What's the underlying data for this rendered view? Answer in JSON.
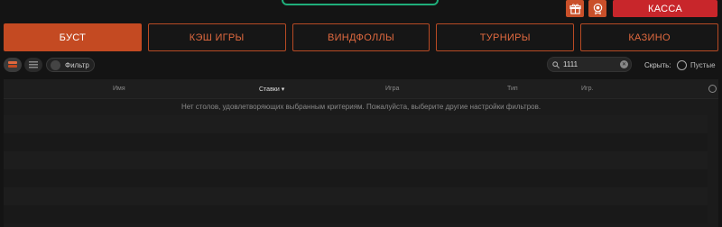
{
  "header": {
    "cashier_label": "КАССА",
    "gift_icon": "gift-icon",
    "badge_icon": "badge-icon"
  },
  "tabs": [
    {
      "label": "БУСТ",
      "active": true
    },
    {
      "label": "КЭШ ИГРЫ",
      "active": false
    },
    {
      "label": "ВИНДФОЛЛЫ",
      "active": false
    },
    {
      "label": "ТУРНИРЫ",
      "active": false
    },
    {
      "label": "КАЗИНО",
      "active": false
    }
  ],
  "toolbar": {
    "filter_label": "Фильтр",
    "search_value": "1111",
    "hide_label": "Скрыть:",
    "empty_label": "Пустые"
  },
  "table": {
    "columns": [
      "Имя",
      "Ставки",
      "Игра",
      "Тип",
      "Игр."
    ],
    "empty_message": "Нет столов, удовлетворяющих выбранным критериям. Пожалуйста, выберите другие настройки фильтров."
  },
  "colors": {
    "accent": "#c44a22",
    "cashier": "#c8262b",
    "frame": "#1fae7a"
  }
}
